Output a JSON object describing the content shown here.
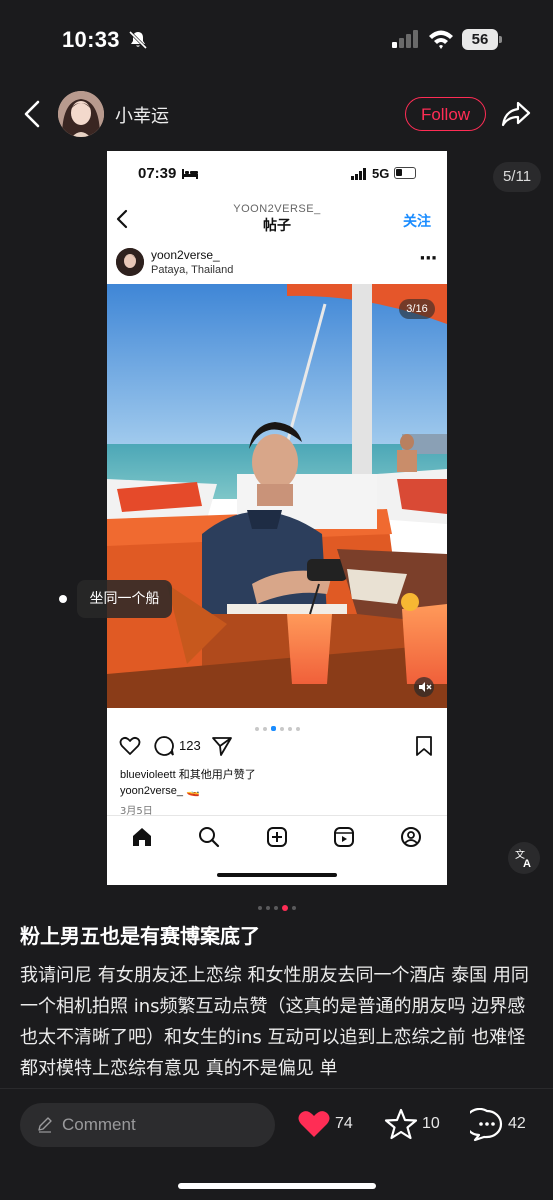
{
  "status_bar": {
    "time": "10:33",
    "battery": "56"
  },
  "header": {
    "username": "小幸运",
    "follow_label": "Follow"
  },
  "carousel": {
    "counter": "5/11",
    "tag_label": "坐同一个船",
    "page_count": 5,
    "active_page": 3
  },
  "screenshot": {
    "time": "07:39",
    "network": "5G",
    "handle": "YOON2VERSE_",
    "title": "帖子",
    "follow_label": "关注",
    "account": "yoon2verse_",
    "location": "Pataya, Thailand",
    "photo_counter": "3/16",
    "comment_count": "123",
    "likes_user": "bluevioleett",
    "likes_suffix": " 和其他用户赞了",
    "caption_user": "yoon2verse_",
    "caption_emoji": "🚤",
    "date": "3月5日"
  },
  "post": {
    "title": "粉上男五也是有赛博案底了",
    "body": "我请问尼 有女朋友还上恋综 和女性朋友去同一个酒店 泰国 用同一个相机拍照 ins频繁互动点赞（这真的是普通的朋友吗 边界感也太不清晰了吧）和女生的ins 互动可以追到上恋综之前 也难怪都对模特上恋综有意见 真的不是偏见 单"
  },
  "bottom_bar": {
    "comment_placeholder": "Comment",
    "like_count": "74",
    "star_count": "10",
    "comment_count": "42"
  },
  "colors": {
    "accent": "#ff2d55",
    "background": "#1b1b1d",
    "ig_blue": "#1a8cff"
  }
}
